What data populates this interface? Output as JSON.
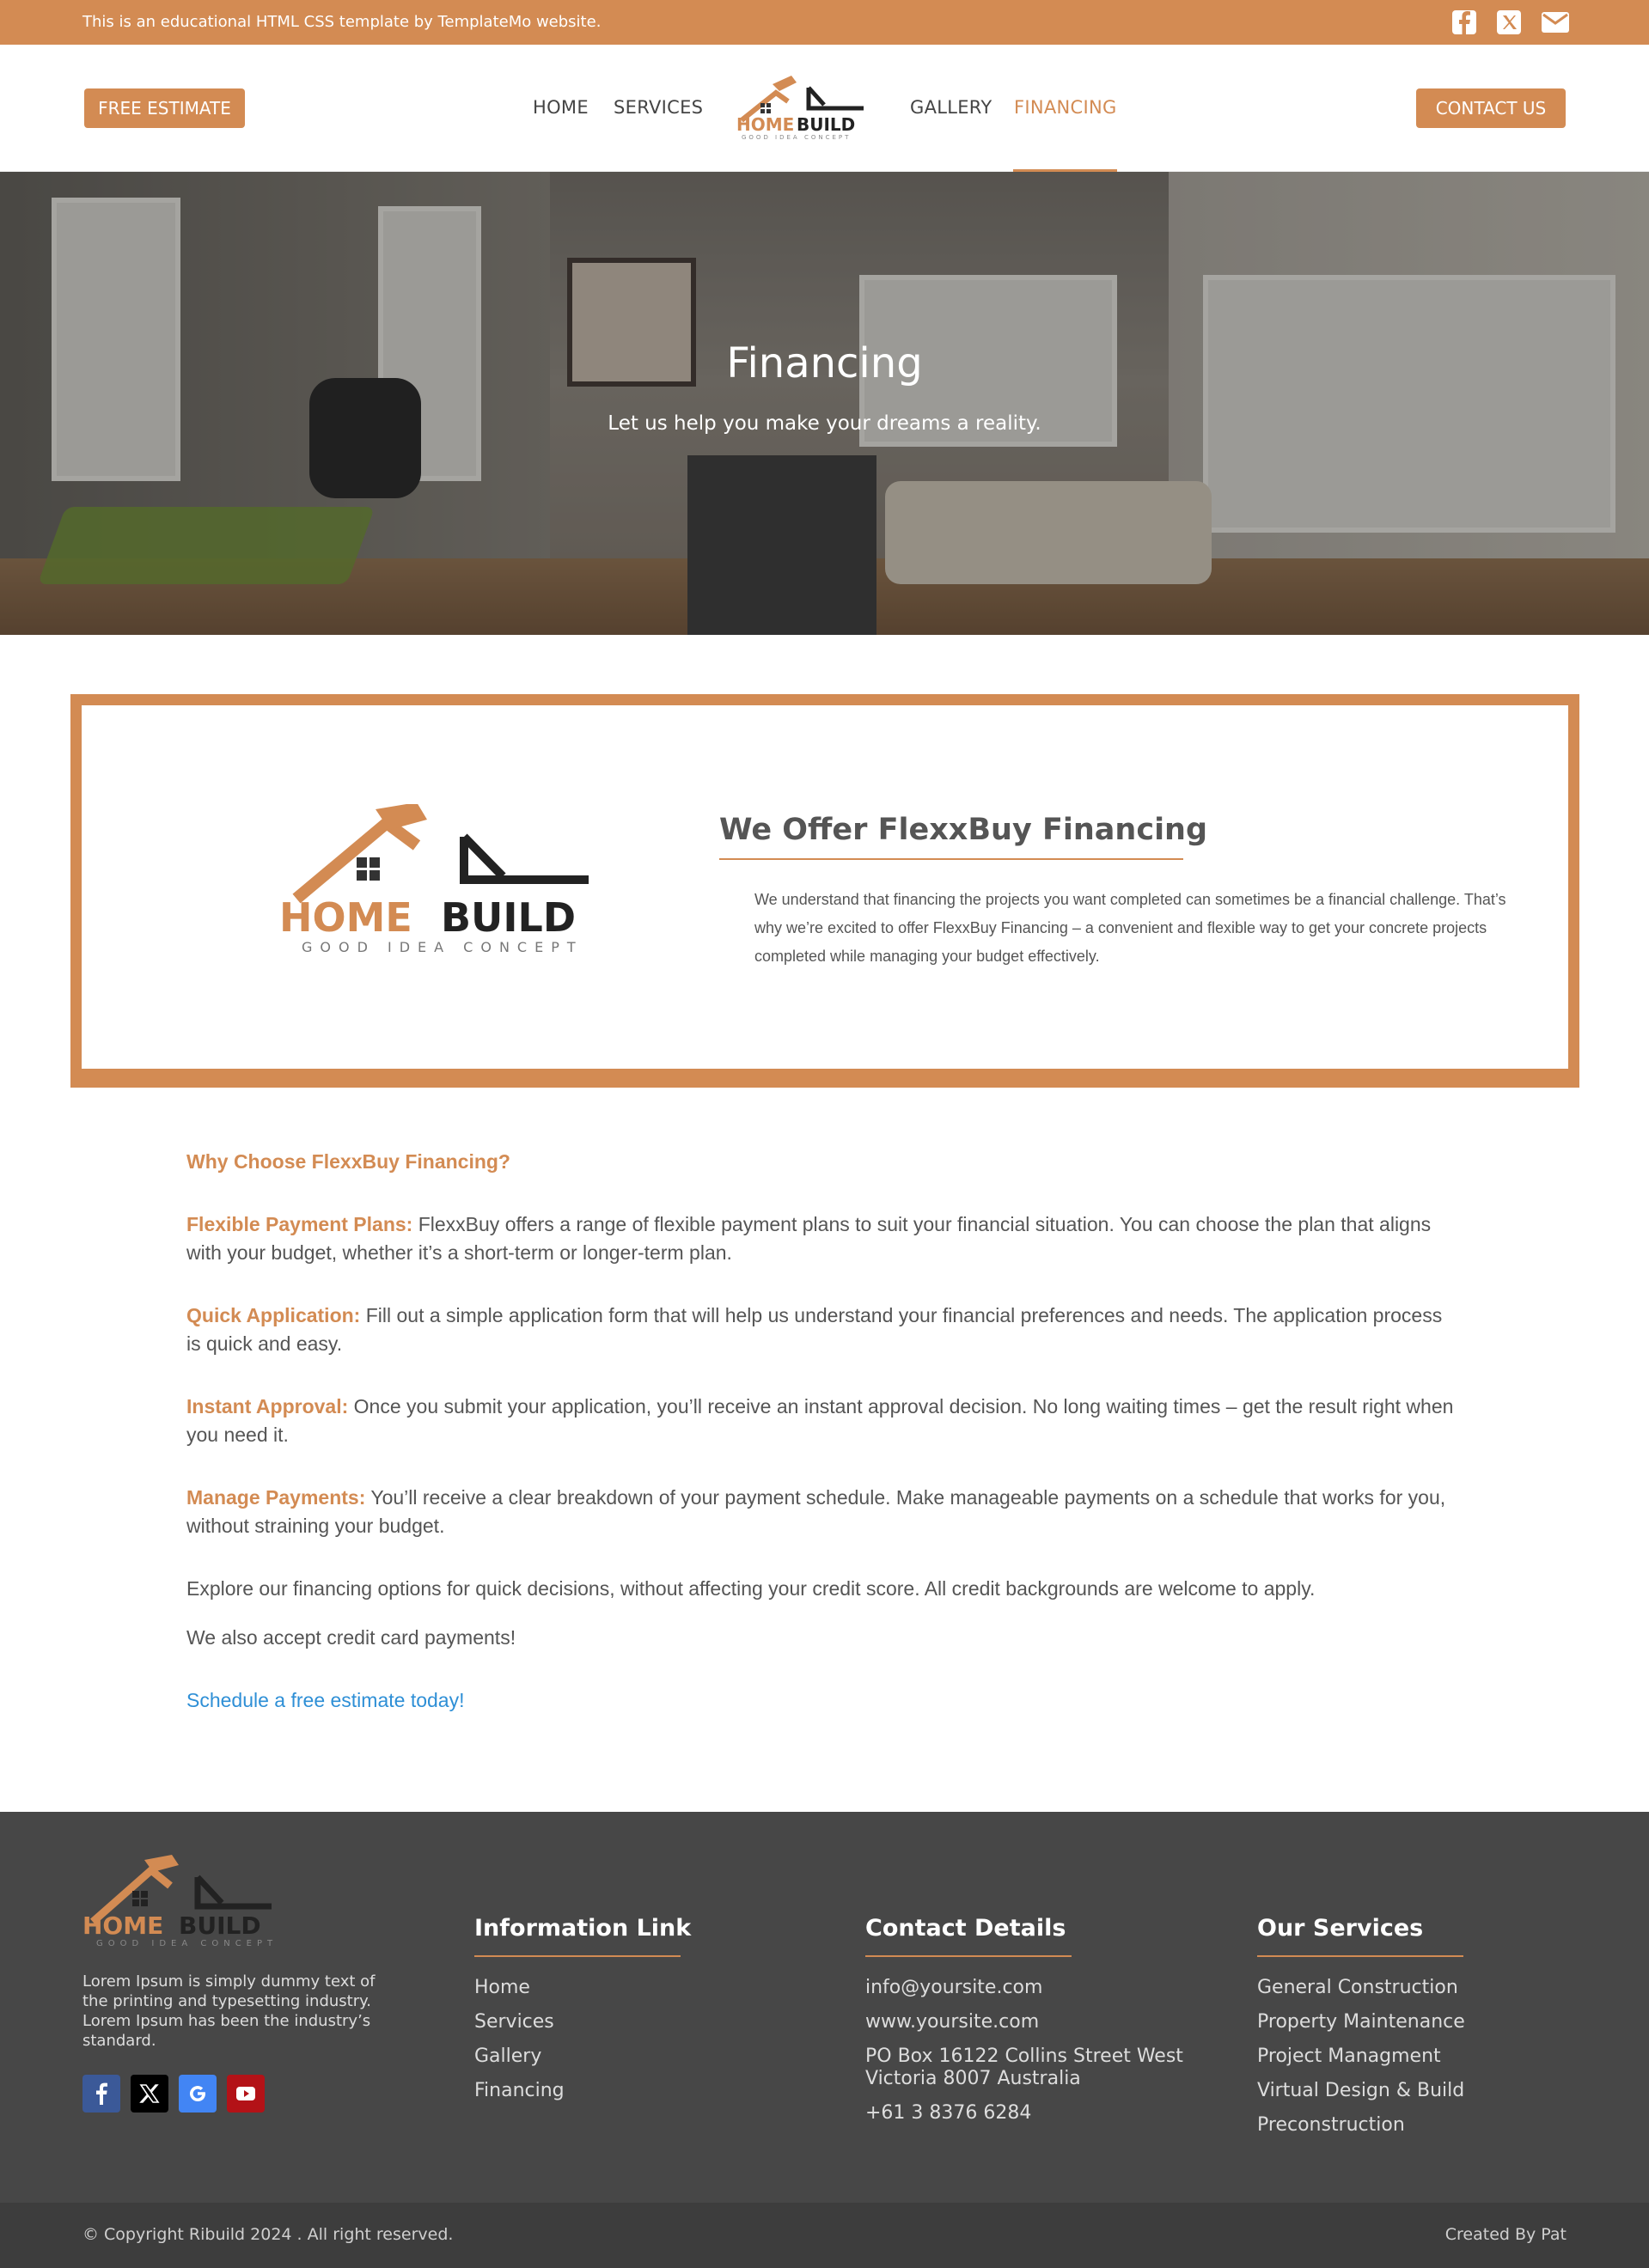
{
  "topbar": {
    "message": "This is an educational HTML CSS template by TemplateMo website.",
    "icons": [
      "facebook-icon",
      "x-twitter-icon",
      "envelope-icon"
    ]
  },
  "header": {
    "free_estimate": "FREE ESTIMATE",
    "contact_us": "CONTACT US",
    "nav": [
      "HOME",
      "SERVICES",
      "GALLERY",
      "FINANCING"
    ],
    "active_nav": "FINANCING",
    "logo": {
      "word1": "HOME",
      "word2": "BUILD",
      "tagline": "GOOD IDEA CONCEPT"
    }
  },
  "hero": {
    "title": "Financing",
    "subtitle": "Let us help you make your dreams a reality."
  },
  "offer": {
    "title": "We Offer FlexxBuy Financing",
    "text": "We understand that financing the projects you want completed can sometimes be a financial challenge. That’s why we’re excited to offer FlexxBuy Financing – a convenient and flexible way to get your concrete projects completed while managing your budget effectively."
  },
  "content": {
    "why": "Why Choose FlexxBuy Financing?",
    "points": [
      {
        "label": "Flexible Payment Plans:",
        "text": " FlexxBuy offers a range of flexible payment plans to suit your financial situation. You can choose the plan that aligns with your budget, whether it’s a short-term or longer-term plan."
      },
      {
        "label": "Quick Application:",
        "text": " Fill out a simple application form that will help us understand your financial preferences and needs. The application process is quick and easy."
      },
      {
        "label": "Instant Approval:",
        "text": " Once you submit your application, you’ll receive an instant approval decision. No long waiting times – get the result right when you need it."
      },
      {
        "label": "Manage Payments:",
        "text": " You’ll receive a clear breakdown of your payment schedule. Make manageable payments on a schedule that works for you, without straining your budget."
      }
    ],
    "explore": "Explore our financing options for quick decisions, without affecting your credit score. All credit backgrounds are welcome to apply.",
    "credit": "We also accept credit card payments!",
    "cta_link": "Schedule a free estimate today!"
  },
  "footer": {
    "about": "Lorem Ipsum is simply dummy text of the printing and typesetting industry. Lorem Ipsum has been the industry’s standard.",
    "socials": [
      "facebook-icon",
      "x-twitter-icon",
      "google-icon",
      "youtube-icon"
    ],
    "info": {
      "title": "Information Link",
      "links": [
        "Home",
        "Services",
        "Gallery",
        "Financing"
      ]
    },
    "contact": {
      "title": "Contact Details",
      "email": "info@yoursite.com",
      "website": "www.yoursite.com",
      "address_line1": "PO Box 16122 Collins Street West",
      "address_line2": "Victoria 8007 Australia",
      "phone": "+61 3 8376 6284"
    },
    "services": {
      "title": "Our Services",
      "items": [
        "General Construction",
        "Property Maintenance",
        "Project Managment",
        "Virtual Design & Build",
        "Preconstruction"
      ]
    },
    "copyright": "© Copyright Ribuild 2024 . All right reserved.",
    "created_by": "Created By Pat"
  },
  "colors": {
    "accent": "#d38b53",
    "footer_bg": "#474747",
    "link": "#2e8fd6"
  }
}
